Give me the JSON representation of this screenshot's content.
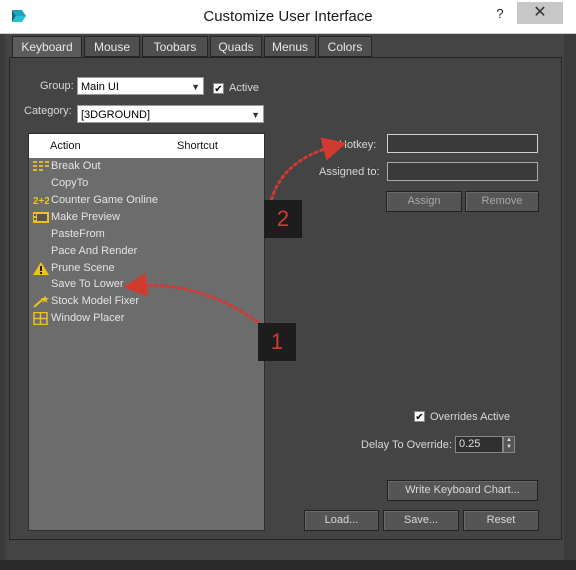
{
  "window": {
    "title": "Customize User Interface",
    "help": "?",
    "close": "✕"
  },
  "tabs": [
    "Keyboard",
    "Mouse",
    "Toobars",
    "Quads",
    "Menus",
    "Colors"
  ],
  "group": {
    "label": "Group:",
    "value": "Main UI",
    "active_label": "Active",
    "active_checked": true
  },
  "category": {
    "label": "Category:",
    "value": "[3DGROUND]"
  },
  "action_list": {
    "headers": {
      "action": "Action",
      "shortcut": "Shortcut"
    },
    "items": [
      {
        "label": "Break Out",
        "icon": "break-out-icon"
      },
      {
        "label": "CopyTo",
        "icon": ""
      },
      {
        "label": "Counter Game Online",
        "icon": "counter-icon"
      },
      {
        "label": "Make Preview",
        "icon": "film-icon"
      },
      {
        "label": "PasteFrom",
        "icon": ""
      },
      {
        "label": "Pace And Render",
        "icon": ""
      },
      {
        "label": "Prune Scene",
        "icon": "warning-icon"
      },
      {
        "label": "Save To Lower",
        "icon": ""
      },
      {
        "label": "Stock Model Fixer",
        "icon": "magic-wand-icon"
      },
      {
        "label": "Window Placer",
        "icon": "grid-icon"
      }
    ]
  },
  "hotkey": {
    "label": "Hotkey:",
    "value": ""
  },
  "assigned": {
    "label": "Assigned to:",
    "value": ""
  },
  "buttons": {
    "assign": "Assign",
    "remove": "Remove",
    "write_chart": "Write Keyboard Chart...",
    "load": "Load...",
    "save": "Save...",
    "reset": "Reset"
  },
  "overrides": {
    "label": "Overrides Active",
    "checked": true
  },
  "delay": {
    "label": "Delay To Override:",
    "value": "0.25"
  },
  "callouts": [
    "1",
    "2"
  ],
  "colors": {
    "accent": "#d23a2f",
    "background": "#444444"
  }
}
